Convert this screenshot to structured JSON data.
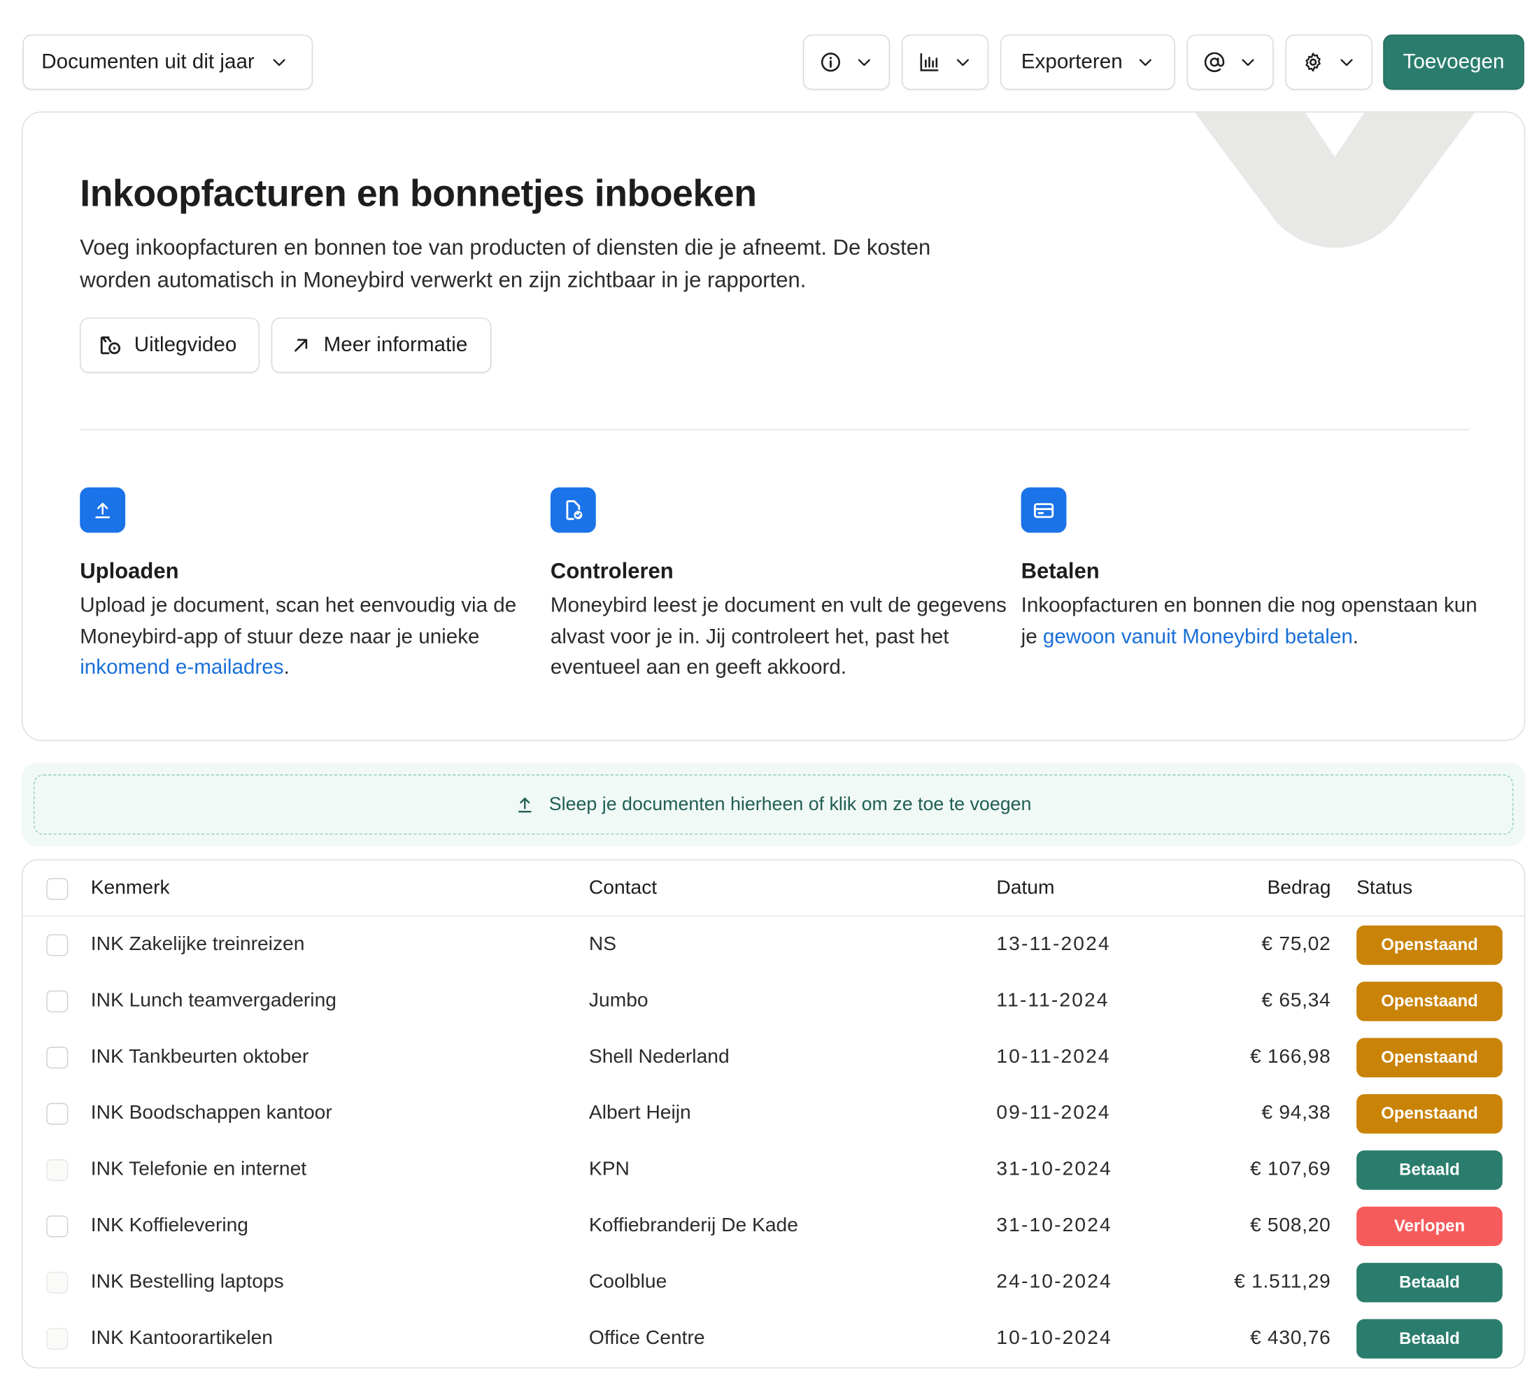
{
  "colors": {
    "primary": "#2a7d6d",
    "link": "#1a6fd8",
    "step_icon_bg": "#1a73e8",
    "status_open": "#c98307",
    "status_paid": "#2a7d6d",
    "status_expired": "#f65b5b"
  },
  "toolbar": {
    "period_label": "Documenten uit dit jaar",
    "export_label": "Exporteren",
    "add_label": "Toevoegen",
    "icons": [
      "info-icon",
      "chart-icon",
      "at-icon",
      "gear-icon"
    ]
  },
  "info": {
    "title": "Inkoopfacturen en bonnetjes inboeken",
    "intro_line1": "Voeg inkoopfacturen en bonnen toe van producten of diensten die je afneemt. De kosten",
    "intro_line2": "worden automatisch in Moneybird verwerkt en zijn zichtbaar in je rapporten.",
    "video_label": "Uitlegvideo",
    "more_label": "Meer informatie",
    "steps": [
      {
        "icon": "upload-icon",
        "title": "Uploaden",
        "text_before": "Upload je document, scan het eenvoudig via de Moneybird-app of stuur deze naar je unieke ",
        "link": "inkomend e-mailadres",
        "text_after": "."
      },
      {
        "icon": "document-check-icon",
        "title": "Controleren",
        "text_before": "Moneybird leest je document en vult de gegevens alvast voor je in. Jij controleert het, past het eventueel aan en geeft akkoord.",
        "link": "",
        "text_after": ""
      },
      {
        "icon": "credit-card-icon",
        "title": "Betalen",
        "text_before": "Inkoopfacturen en bonnen die nog openstaan kun je ",
        "link": "gewoon vanuit Moneybird betalen",
        "text_after": "."
      }
    ]
  },
  "dropzone": {
    "label": "Sleep je documenten hierheen of klik om ze toe te voegen"
  },
  "table": {
    "headers": {
      "kenmerk": "Kenmerk",
      "contact": "Contact",
      "datum": "Datum",
      "bedrag": "Bedrag",
      "status": "Status"
    },
    "rows": [
      {
        "kenmerk": "INK Zakelijke treinreizen",
        "contact": "NS",
        "datum": "13-11-2024",
        "bedrag": "€ 75,02",
        "status": "Openstaand",
        "status_type": "open",
        "muted": false
      },
      {
        "kenmerk": "INK Lunch teamvergadering",
        "contact": "Jumbo",
        "datum": "11-11-2024",
        "bedrag": "€ 65,34",
        "status": "Openstaand",
        "status_type": "open",
        "muted": false
      },
      {
        "kenmerk": "INK Tankbeurten oktober",
        "contact": "Shell Nederland",
        "datum": "10-11-2024",
        "bedrag": "€ 166,98",
        "status": "Openstaand",
        "status_type": "open",
        "muted": false
      },
      {
        "kenmerk": "INK Boodschappen kantoor",
        "contact": "Albert Heijn",
        "datum": "09-11-2024",
        "bedrag": "€ 94,38",
        "status": "Openstaand",
        "status_type": "open",
        "muted": false
      },
      {
        "kenmerk": "INK Telefonie en internet",
        "contact": "KPN",
        "datum": "31-10-2024",
        "bedrag": "€ 107,69",
        "status": "Betaald",
        "status_type": "paid",
        "muted": true
      },
      {
        "kenmerk": "INK Koffielevering",
        "contact": "Koffiebranderij De Kade",
        "datum": "31-10-2024",
        "bedrag": "€ 508,20",
        "status": "Verlopen",
        "status_type": "expired",
        "muted": false
      },
      {
        "kenmerk": "INK Bestelling laptops",
        "contact": "Coolblue",
        "datum": "24-10-2024",
        "bedrag": "€ 1.511,29",
        "status": "Betaald",
        "status_type": "paid",
        "muted": true
      },
      {
        "kenmerk": "INK Kantoorartikelen",
        "contact": "Office Centre",
        "datum": "10-10-2024",
        "bedrag": "€ 430,76",
        "status": "Betaald",
        "status_type": "paid",
        "muted": true
      }
    ]
  }
}
